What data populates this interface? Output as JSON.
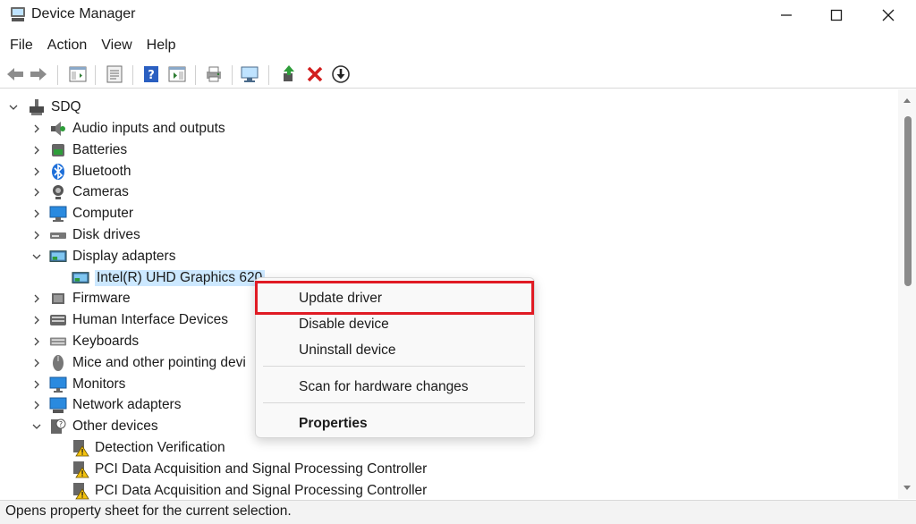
{
  "window": {
    "title": "Device Manager"
  },
  "menu": [
    "File",
    "Action",
    "View",
    "Help"
  ],
  "tree": {
    "root": "SDQ",
    "items": [
      {
        "label": "Audio inputs and outputs",
        "icon": "speaker-icon"
      },
      {
        "label": "Batteries",
        "icon": "battery-icon"
      },
      {
        "label": "Bluetooth",
        "icon": "bluetooth-icon"
      },
      {
        "label": "Cameras",
        "icon": "camera-icon"
      },
      {
        "label": "Computer",
        "icon": "computer-icon"
      },
      {
        "label": "Disk drives",
        "icon": "disk-drive-icon"
      },
      {
        "label": "Display adapters",
        "icon": "display-adapter-icon"
      },
      {
        "label": "Intel(R) UHD Graphics 620",
        "icon": "display-adapter-icon"
      },
      {
        "label": "Firmware",
        "icon": "firmware-icon"
      },
      {
        "label": "Human Interface Devices",
        "icon": "hid-icon"
      },
      {
        "label": "Keyboards",
        "icon": "keyboard-icon"
      },
      {
        "label": "Mice and other pointing devi",
        "icon": "mouse-icon"
      },
      {
        "label": "Monitors",
        "icon": "monitor-icon"
      },
      {
        "label": "Network adapters",
        "icon": "network-adapter-icon"
      },
      {
        "label": "Other devices",
        "icon": "unknown-device-icon"
      },
      {
        "label": "Detection Verification",
        "icon": "warning-device-icon"
      },
      {
        "label": "PCI Data Acquisition and Signal Processing Controller",
        "icon": "warning-device-icon"
      },
      {
        "label": "PCI Data Acquisition and Signal Processing Controller",
        "icon": "warning-device-icon"
      }
    ]
  },
  "context_menu": {
    "update": "Update driver",
    "disable": "Disable device",
    "uninstall": "Uninstall device",
    "scan": "Scan for hardware changes",
    "properties": "Properties"
  },
  "status": "Opens property sheet for the current selection.",
  "colors": {
    "highlight": "#e01b24",
    "selection": "#cce8ff"
  }
}
